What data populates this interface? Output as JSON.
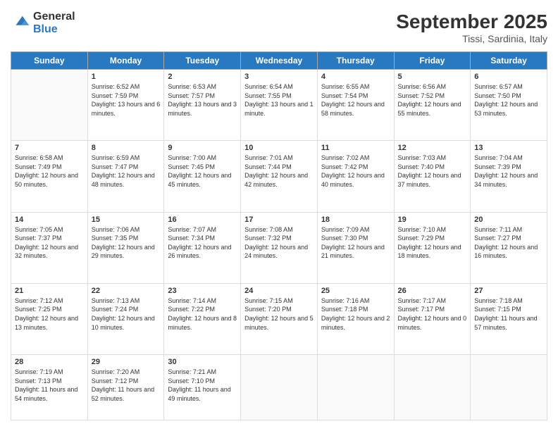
{
  "header": {
    "logo_line1": "General",
    "logo_line2": "Blue",
    "month_title": "September 2025",
    "location": "Tissi, Sardinia, Italy"
  },
  "days_of_week": [
    "Sunday",
    "Monday",
    "Tuesday",
    "Wednesday",
    "Thursday",
    "Friday",
    "Saturday"
  ],
  "weeks": [
    [
      {
        "day": "",
        "sunrise": "",
        "sunset": "",
        "daylight": ""
      },
      {
        "day": "1",
        "sunrise": "Sunrise: 6:52 AM",
        "sunset": "Sunset: 7:59 PM",
        "daylight": "Daylight: 13 hours and 6 minutes."
      },
      {
        "day": "2",
        "sunrise": "Sunrise: 6:53 AM",
        "sunset": "Sunset: 7:57 PM",
        "daylight": "Daylight: 13 hours and 3 minutes."
      },
      {
        "day": "3",
        "sunrise": "Sunrise: 6:54 AM",
        "sunset": "Sunset: 7:55 PM",
        "daylight": "Daylight: 13 hours and 1 minute."
      },
      {
        "day": "4",
        "sunrise": "Sunrise: 6:55 AM",
        "sunset": "Sunset: 7:54 PM",
        "daylight": "Daylight: 12 hours and 58 minutes."
      },
      {
        "day": "5",
        "sunrise": "Sunrise: 6:56 AM",
        "sunset": "Sunset: 7:52 PM",
        "daylight": "Daylight: 12 hours and 55 minutes."
      },
      {
        "day": "6",
        "sunrise": "Sunrise: 6:57 AM",
        "sunset": "Sunset: 7:50 PM",
        "daylight": "Daylight: 12 hours and 53 minutes."
      }
    ],
    [
      {
        "day": "7",
        "sunrise": "Sunrise: 6:58 AM",
        "sunset": "Sunset: 7:49 PM",
        "daylight": "Daylight: 12 hours and 50 minutes."
      },
      {
        "day": "8",
        "sunrise": "Sunrise: 6:59 AM",
        "sunset": "Sunset: 7:47 PM",
        "daylight": "Daylight: 12 hours and 48 minutes."
      },
      {
        "day": "9",
        "sunrise": "Sunrise: 7:00 AM",
        "sunset": "Sunset: 7:45 PM",
        "daylight": "Daylight: 12 hours and 45 minutes."
      },
      {
        "day": "10",
        "sunrise": "Sunrise: 7:01 AM",
        "sunset": "Sunset: 7:44 PM",
        "daylight": "Daylight: 12 hours and 42 minutes."
      },
      {
        "day": "11",
        "sunrise": "Sunrise: 7:02 AM",
        "sunset": "Sunset: 7:42 PM",
        "daylight": "Daylight: 12 hours and 40 minutes."
      },
      {
        "day": "12",
        "sunrise": "Sunrise: 7:03 AM",
        "sunset": "Sunset: 7:40 PM",
        "daylight": "Daylight: 12 hours and 37 minutes."
      },
      {
        "day": "13",
        "sunrise": "Sunrise: 7:04 AM",
        "sunset": "Sunset: 7:39 PM",
        "daylight": "Daylight: 12 hours and 34 minutes."
      }
    ],
    [
      {
        "day": "14",
        "sunrise": "Sunrise: 7:05 AM",
        "sunset": "Sunset: 7:37 PM",
        "daylight": "Daylight: 12 hours and 32 minutes."
      },
      {
        "day": "15",
        "sunrise": "Sunrise: 7:06 AM",
        "sunset": "Sunset: 7:35 PM",
        "daylight": "Daylight: 12 hours and 29 minutes."
      },
      {
        "day": "16",
        "sunrise": "Sunrise: 7:07 AM",
        "sunset": "Sunset: 7:34 PM",
        "daylight": "Daylight: 12 hours and 26 minutes."
      },
      {
        "day": "17",
        "sunrise": "Sunrise: 7:08 AM",
        "sunset": "Sunset: 7:32 PM",
        "daylight": "Daylight: 12 hours and 24 minutes."
      },
      {
        "day": "18",
        "sunrise": "Sunrise: 7:09 AM",
        "sunset": "Sunset: 7:30 PM",
        "daylight": "Daylight: 12 hours and 21 minutes."
      },
      {
        "day": "19",
        "sunrise": "Sunrise: 7:10 AM",
        "sunset": "Sunset: 7:29 PM",
        "daylight": "Daylight: 12 hours and 18 minutes."
      },
      {
        "day": "20",
        "sunrise": "Sunrise: 7:11 AM",
        "sunset": "Sunset: 7:27 PM",
        "daylight": "Daylight: 12 hours and 16 minutes."
      }
    ],
    [
      {
        "day": "21",
        "sunrise": "Sunrise: 7:12 AM",
        "sunset": "Sunset: 7:25 PM",
        "daylight": "Daylight: 12 hours and 13 minutes."
      },
      {
        "day": "22",
        "sunrise": "Sunrise: 7:13 AM",
        "sunset": "Sunset: 7:24 PM",
        "daylight": "Daylight: 12 hours and 10 minutes."
      },
      {
        "day": "23",
        "sunrise": "Sunrise: 7:14 AM",
        "sunset": "Sunset: 7:22 PM",
        "daylight": "Daylight: 12 hours and 8 minutes."
      },
      {
        "day": "24",
        "sunrise": "Sunrise: 7:15 AM",
        "sunset": "Sunset: 7:20 PM",
        "daylight": "Daylight: 12 hours and 5 minutes."
      },
      {
        "day": "25",
        "sunrise": "Sunrise: 7:16 AM",
        "sunset": "Sunset: 7:18 PM",
        "daylight": "Daylight: 12 hours and 2 minutes."
      },
      {
        "day": "26",
        "sunrise": "Sunrise: 7:17 AM",
        "sunset": "Sunset: 7:17 PM",
        "daylight": "Daylight: 12 hours and 0 minutes."
      },
      {
        "day": "27",
        "sunrise": "Sunrise: 7:18 AM",
        "sunset": "Sunset: 7:15 PM",
        "daylight": "Daylight: 11 hours and 57 minutes."
      }
    ],
    [
      {
        "day": "28",
        "sunrise": "Sunrise: 7:19 AM",
        "sunset": "Sunset: 7:13 PM",
        "daylight": "Daylight: 11 hours and 54 minutes."
      },
      {
        "day": "29",
        "sunrise": "Sunrise: 7:20 AM",
        "sunset": "Sunset: 7:12 PM",
        "daylight": "Daylight: 11 hours and 52 minutes."
      },
      {
        "day": "30",
        "sunrise": "Sunrise: 7:21 AM",
        "sunset": "Sunset: 7:10 PM",
        "daylight": "Daylight: 11 hours and 49 minutes."
      },
      {
        "day": "",
        "sunrise": "",
        "sunset": "",
        "daylight": ""
      },
      {
        "day": "",
        "sunrise": "",
        "sunset": "",
        "daylight": ""
      },
      {
        "day": "",
        "sunrise": "",
        "sunset": "",
        "daylight": ""
      },
      {
        "day": "",
        "sunrise": "",
        "sunset": "",
        "daylight": ""
      }
    ]
  ]
}
